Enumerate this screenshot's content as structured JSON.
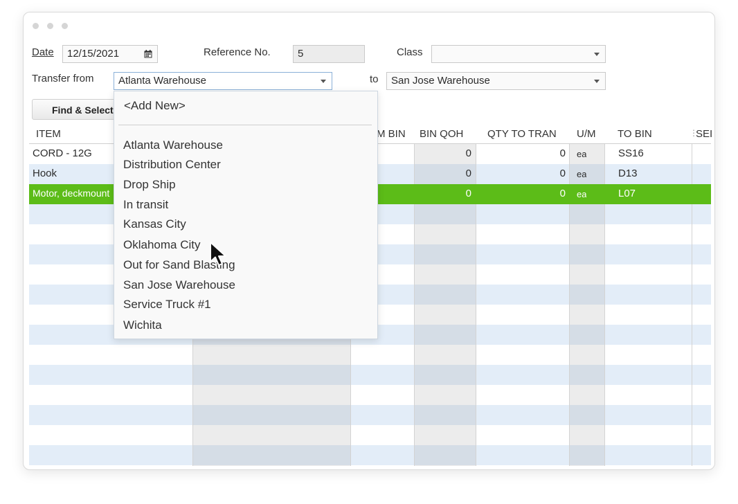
{
  "header": {
    "date_label": "Date",
    "date_value": "12/15/2021",
    "reference_label": "Reference No.",
    "reference_value": "5",
    "class_label": "Class",
    "class_value": "",
    "transfer_from_label": "Transfer from",
    "transfer_from_value": "Atlanta Warehouse",
    "to_label": "to",
    "to_value": "San Jose Warehouse",
    "find_button_label": "Find & Select"
  },
  "table": {
    "columns": {
      "item": "ITEM",
      "from_bin": "M BIN",
      "bin_qoh": "BIN QOH",
      "qty_to_transfer": "QTY TO TRAN",
      "um": "U/M",
      "to_bin": "TO BIN",
      "serial": "SEI"
    },
    "rows": [
      {
        "item": "CORD - 12G",
        "bin_qoh": "0",
        "qty": "0",
        "um": "ea",
        "to_bin": "SS16"
      },
      {
        "item": "Hook",
        "bin_qoh": "0",
        "qty": "0",
        "um": "ea",
        "to_bin": "D13"
      },
      {
        "item": "Motor, deckmount",
        "bin_qoh": "0",
        "qty": "0",
        "um": "ea",
        "to_bin": "L07"
      }
    ]
  },
  "dropdown": {
    "add_new": "<Add New>",
    "items": [
      "Atlanta Warehouse",
      "Distribution Center",
      "Drop Ship",
      "In transit",
      "Kansas City",
      "Oklahoma City",
      "Out for Sand Blasting",
      "San Jose Warehouse",
      "Service Truck #1",
      "Wichita"
    ]
  },
  "colors": {
    "selected_row": "#5cbc18",
    "stripe": "#e3edf8"
  },
  "icons": {
    "calendar": "calendar-icon",
    "dropdown": "chevron-down-icon",
    "cursor": "mouse-pointer-icon"
  }
}
